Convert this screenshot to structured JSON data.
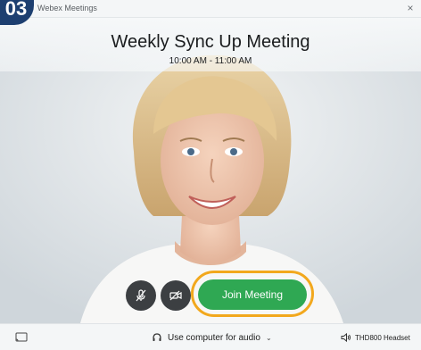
{
  "step": {
    "number": "03"
  },
  "window": {
    "title": "Webex Meetings",
    "close_glyph": "×"
  },
  "meeting": {
    "title": "Weekly Sync Up Meeting",
    "time": "10:00 AM - 11:00 AM"
  },
  "controls": {
    "mute_icon": "mic-muted-icon",
    "video_icon": "video-off-icon",
    "join_label": "Join Meeting"
  },
  "bottom_bar": {
    "audio_label": "Use computer for audio",
    "audio_chevron": "⌄",
    "speaker_label": "THD800 Headset"
  },
  "colors": {
    "join_green": "#2fa853",
    "highlight_orange": "#f2a81d",
    "badge_navy": "#1d3f70",
    "control_dark": "#3c3f42"
  }
}
